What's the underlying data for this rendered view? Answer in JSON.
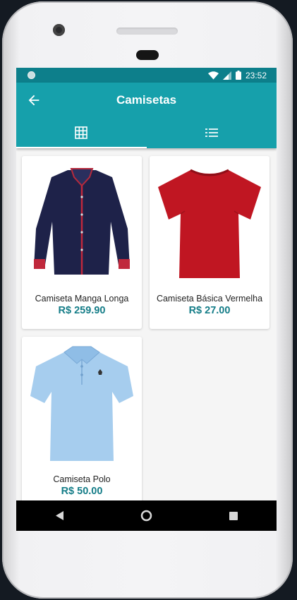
{
  "status_bar": {
    "time": "23:52"
  },
  "app_bar": {
    "title": "Camisetas",
    "back_icon": "arrow-left-icon"
  },
  "tabs": [
    {
      "icon": "grid-view-icon",
      "active": true
    },
    {
      "icon": "list-view-icon",
      "active": false
    }
  ],
  "products": [
    {
      "name": "Camiseta Manga Longa",
      "price": "R$ 259.90",
      "image": "long-sleeve-shirt-icon"
    },
    {
      "name": "Camiseta Básica Vermelha",
      "price": "R$ 27.00",
      "image": "red-tshirt-icon"
    },
    {
      "name": "Camiseta Polo",
      "price": "R$ 50.00",
      "image": "polo-shirt-icon"
    }
  ],
  "colors": {
    "primary": "#16a0ab",
    "primary_dark": "#0d7f8b",
    "price": "#157d88"
  }
}
